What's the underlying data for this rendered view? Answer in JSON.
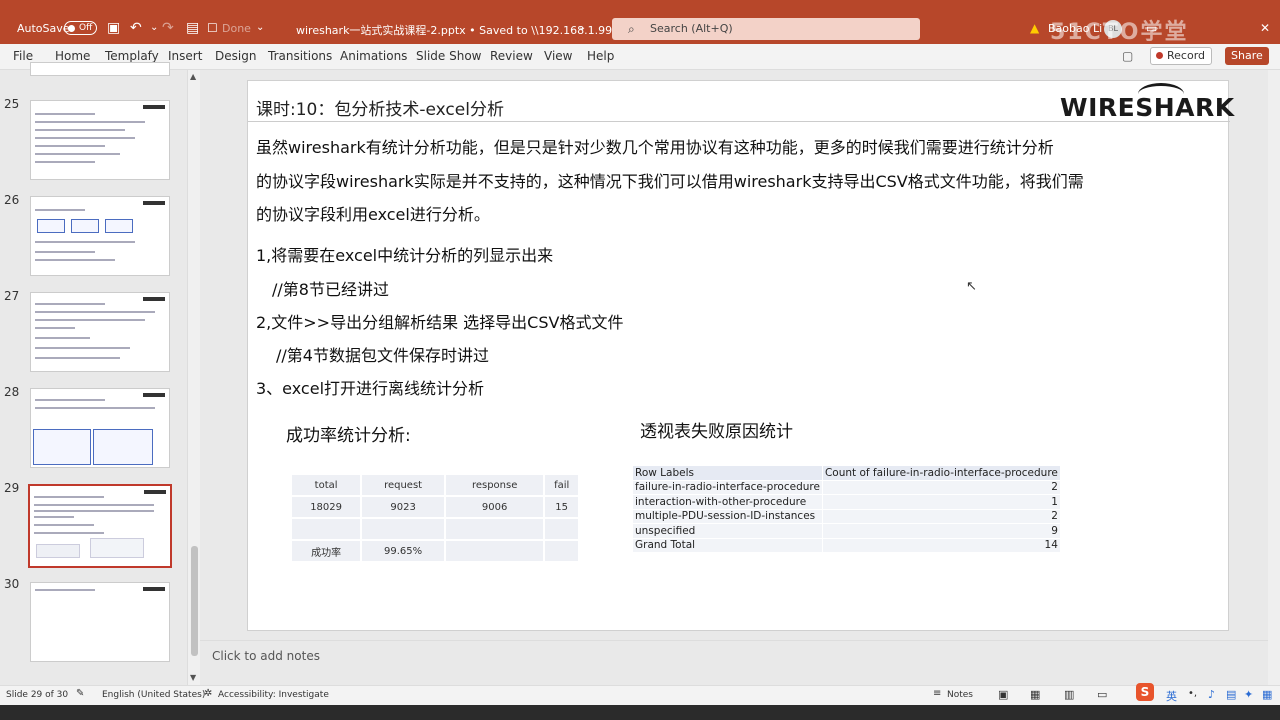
{
  "titlebar": {
    "autosave_label": "AutoSave",
    "autosave_state": "Off",
    "done_label": "Done",
    "file_title": "wireshark一站式实战课程-2.pptx • Saved to \\\\192.168.1.99\\work",
    "search_placeholder": "Search (Alt+Q)",
    "user_name": "Baobao Li",
    "user_initials": "BL",
    "accent_color": "#b7472a"
  },
  "ribbon": {
    "tabs": [
      "File",
      "Home",
      "Templafy",
      "Insert",
      "Design",
      "Transitions",
      "Animations",
      "Slide Show",
      "Review",
      "View",
      "Help"
    ],
    "record_label": "Record",
    "share_label": "Share"
  },
  "thumbnails": [
    {
      "num": "25"
    },
    {
      "num": "26"
    },
    {
      "num": "27"
    },
    {
      "num": "28"
    },
    {
      "num": "29",
      "active": true
    },
    {
      "num": "30"
    }
  ],
  "slide": {
    "lesson_title": "课时:10：包分析技术-excel分析",
    "logo_text": "WIRESHARK",
    "intro_lines": [
      "虽然wireshark有统计分析功能，但是只是针对少数几个常用协议有这种功能，更多的时候我们需要进行统计分析",
      "的协议字段wireshark实际是并不支持的，这种情况下我们可以借用wireshark支持导出CSV格式文件功能，将我们需",
      "的协议字段利用excel进行分析。"
    ],
    "steps": [
      "1,将需要在excel中统计分析的列显示出来",
      "//第8节已经讲过",
      "2,文件>>导出分组解析结果 选择导出CSV格式文件",
      "//第4节数据包文件保存时讲过",
      "3、excel打开进行离线统计分析"
    ],
    "success_heading": "成功率统计分析:",
    "pivot_heading": "透视表失败原因统计",
    "success_table": {
      "headers": [
        "total",
        "request",
        "response",
        "fail"
      ],
      "values": [
        "18029",
        "9023",
        "9006",
        "15"
      ],
      "rate_label": "成功率",
      "rate_value": "99.65%"
    },
    "pivot_table": {
      "col1": "Row Labels",
      "col2": "Count of failure-in-radio-interface-procedure",
      "rows": [
        {
          "label": "failure-in-radio-interface-procedure",
          "value": "2"
        },
        {
          "label": "interaction-with-other-procedure",
          "value": "1"
        },
        {
          "label": "multiple-PDU-session-ID-instances",
          "value": "2"
        },
        {
          "label": "unspecified",
          "value": "9"
        },
        {
          "label": "Grand Total",
          "value": "14"
        }
      ]
    }
  },
  "notes": {
    "placeholder": "Click to add notes"
  },
  "status": {
    "slide_info": "Slide 29 of 30",
    "language": "English (United States)",
    "accessibility": "Accessibility: Investigate",
    "notes_label": "Notes",
    "ime_label": "英"
  },
  "watermark": "51CTO学堂"
}
